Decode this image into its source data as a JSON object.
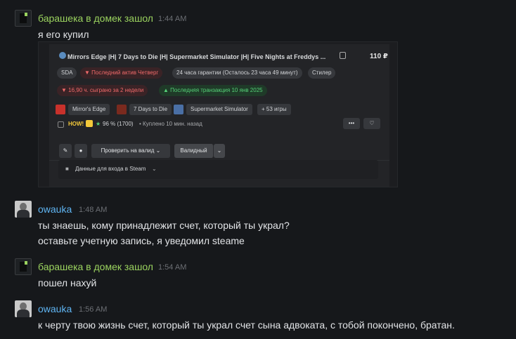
{
  "messages": [
    {
      "user": "барашека в домек зашол",
      "time": "1:44 AM",
      "lines": [
        "я его купил"
      ]
    },
    {
      "user": "owauka",
      "time": "1:48 AM",
      "lines": [
        "ты знаешь, кому принадлежит счет, который ты украл?",
        "оставьте учетную запись, я уведомил steame"
      ]
    },
    {
      "user": "барашека в домек зашол",
      "time": "1:54 AM",
      "lines": [
        "пошел нахуй"
      ]
    },
    {
      "user": "owauka",
      "time": "1:56 AM",
      "lines": [
        "к черту твою жизнь счет, который ты украл счет сына адвоката, с тобой покончено, братан."
      ]
    }
  ],
  "listing": {
    "title": "Mirrors Edge |H| 7 Days to Die |H| Supermarket Simulator |H| Five Nights at Freddys ...",
    "price": "110 ₽",
    "tags_row1": [
      "SDA",
      "Последний актив Четверг",
      "24 часа гарантии (Осталось 23 часа 49 минут)",
      "Стилер"
    ],
    "tags_row2": [
      "16,90 ч. сыграно за 2 недели",
      "Последняя транзакция 10 янв 2025"
    ],
    "games": [
      "Mirror's Edge",
      "7 Days to Die",
      "Supermarket Simulator",
      "+ 53 игры"
    ],
    "rating": "96 % (1700)",
    "badge": "HOW!",
    "bought": "Куплено 10 мин. назад",
    "more": "•••",
    "check_button": "Проверить на валид",
    "valid_button": "Валидный",
    "login_data": "Данные для входа в Steam"
  },
  "colors": {
    "background": "#16181b",
    "user_green": "#9bd35f",
    "user_blue": "#5fb4f2"
  }
}
